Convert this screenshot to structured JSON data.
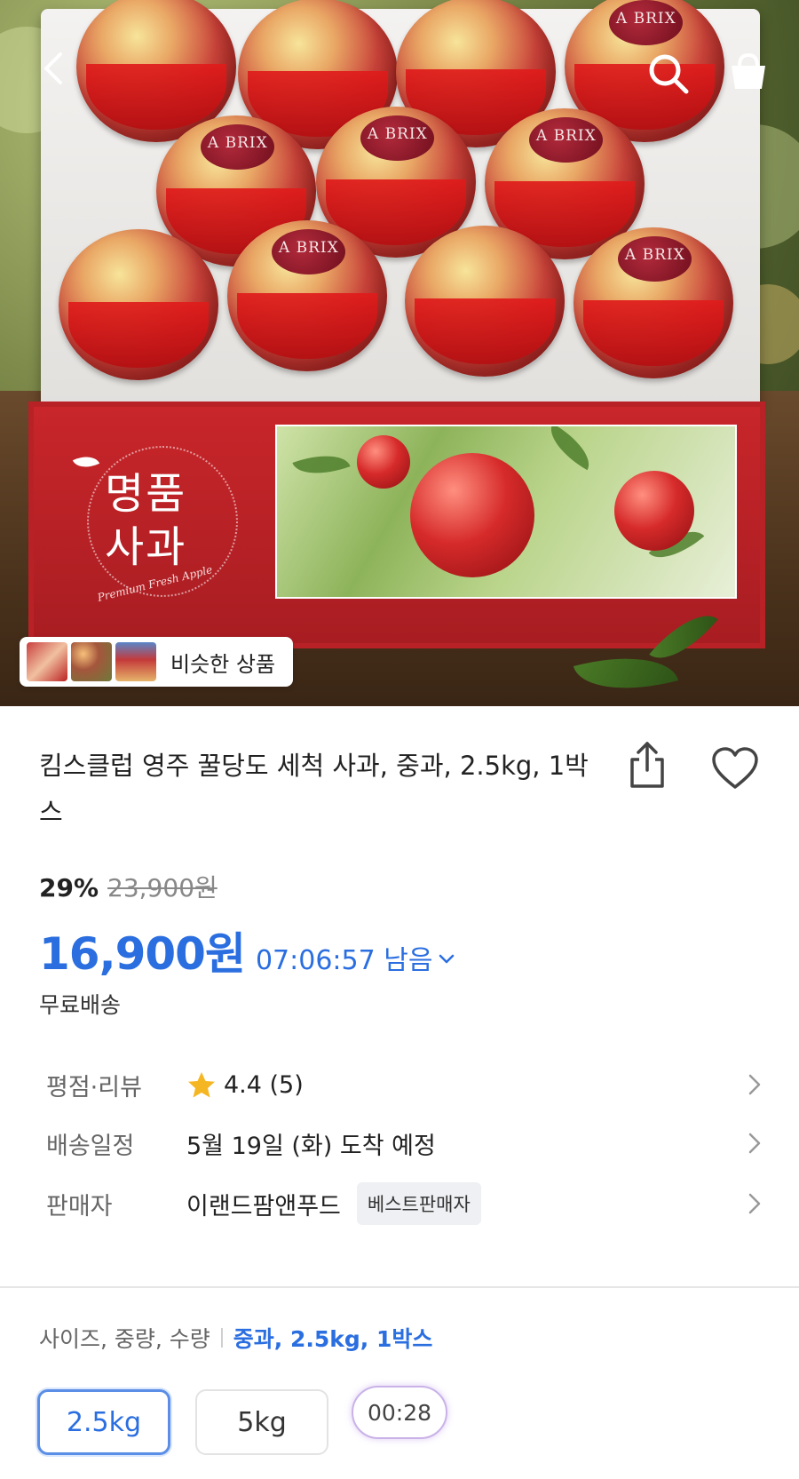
{
  "product": {
    "image_label_line1": "명품",
    "image_label_line2": "사과",
    "image_label_sub": "Premium Fresh Apple",
    "apple_tag": "A BRIX",
    "similar_label": "비슷한 상품",
    "title": "킴스클럽 영주 꿀당도 세척 사과, 중과, 2.5kg, 1박스"
  },
  "pricing": {
    "discount": "29%",
    "original_price": "23,900원",
    "sale_price": "16,900원",
    "time_left": "07:06:57 남음",
    "shipping": "무료배송"
  },
  "details": [
    {
      "key": "평점·리뷰",
      "value": "4.4 (5)",
      "rating": 4.4
    },
    {
      "key": "배송일정",
      "value": "5월 19일 (화) 도착 예정"
    },
    {
      "key": "판매자",
      "value": "이랜드팜앤푸드",
      "badge": "베스트판매자"
    }
  ],
  "options": {
    "label": "사이즈, 중량, 수량",
    "selected": "중과, 2.5kg, 1박스",
    "choices": [
      "2.5kg",
      "5kg"
    ],
    "video_timer": "00:28"
  },
  "colors": {
    "accent": "#2a6ee0",
    "star": "#f5b623"
  },
  "icons": {
    "back": "chevron-left-icon",
    "search": "search-icon",
    "cart": "shopping-bag-icon",
    "share": "share-icon",
    "wishlist": "heart-icon",
    "rating": "star-icon",
    "expand": "chevron-down-icon",
    "row_arrow": "chevron-right-icon"
  }
}
